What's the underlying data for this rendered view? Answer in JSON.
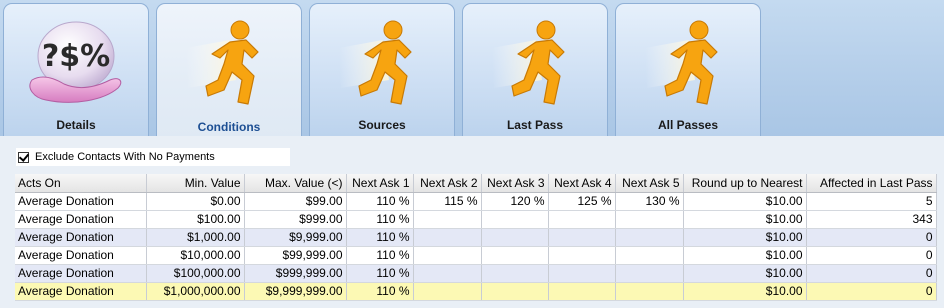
{
  "tabs": [
    {
      "label": "Details",
      "icon": "money-symbols-hand-icon",
      "active": false
    },
    {
      "label": "Conditions",
      "icon": "running-man-icon",
      "active": true
    },
    {
      "label": "Sources",
      "icon": "running-man-icon",
      "active": false
    },
    {
      "label": "Last Pass",
      "icon": "running-man-icon",
      "active": false
    },
    {
      "label": "All Passes",
      "icon": "running-man-icon",
      "active": false
    }
  ],
  "details_icon_text": "?$%",
  "exclude_checkbox": {
    "label": "Exclude Contacts With No Payments",
    "checked": true
  },
  "grid": {
    "columns": [
      "Acts On",
      "Min. Value",
      "Max. Value (<)",
      "Next Ask 1",
      "Next Ask 2",
      "Next Ask 3",
      "Next Ask 4",
      "Next Ask 5",
      "Round up to Nearest",
      "Affected in Last Pass"
    ],
    "rows": [
      [
        "Average Donation",
        "$0.00",
        "$99.00",
        "110 %",
        "115 %",
        "120 %",
        "125 %",
        "130 %",
        "$10.00",
        "5"
      ],
      [
        "Average Donation",
        "$100.00",
        "$999.00",
        "110 %",
        "",
        "",
        "",
        "",
        "$10.00",
        "343"
      ],
      [
        "Average Donation",
        "$1,000.00",
        "$9,999.00",
        "110 %",
        "",
        "",
        "",
        "",
        "$10.00",
        "0"
      ],
      [
        "Average Donation",
        "$10,000.00",
        "$99,999.00",
        "110 %",
        "",
        "",
        "",
        "",
        "$10.00",
        "0"
      ],
      [
        "Average Donation",
        "$100,000.00",
        "$999,999.00",
        "110 %",
        "",
        "",
        "",
        "",
        "$10.00",
        "0"
      ],
      [
        "Average Donation",
        "$1,000,000.00",
        "$9,999,999.00",
        "110 %",
        "",
        "",
        "",
        "",
        "$10.00",
        "0"
      ]
    ],
    "selected_row": 5
  },
  "colors": {
    "tabstrip_bg": "#b3cde9",
    "active_label": "#1d4f93",
    "runner_orange": "#f7a410",
    "row_alt": "#e4e8f6",
    "row_selected": "#fcf9b4"
  }
}
